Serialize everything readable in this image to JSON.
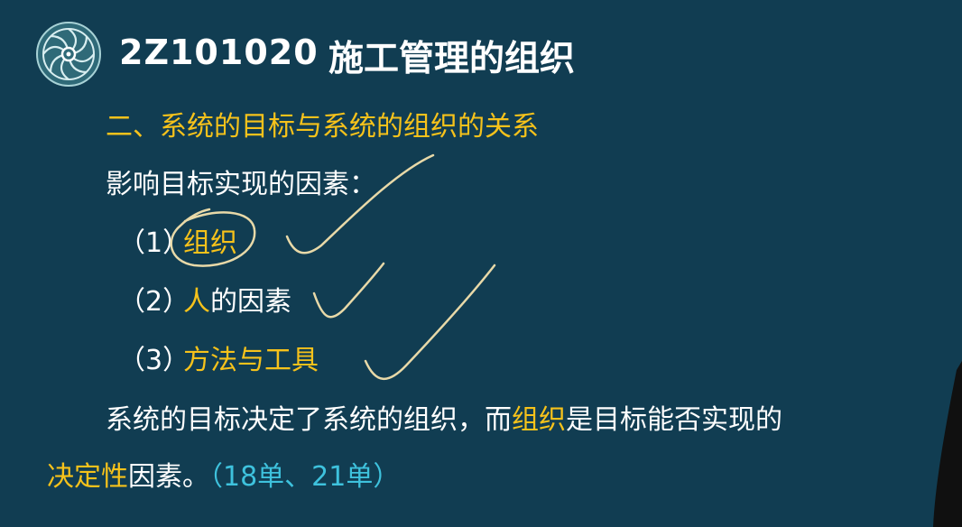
{
  "header": {
    "code": "2Z101020",
    "title": "施工管理的组织"
  },
  "section": {
    "heading": "二、系统的目标与系统的组织的关系",
    "intro": "影响目标实现的因素："
  },
  "factors": [
    {
      "num": "（1）",
      "highlight": "组织",
      "rest": ""
    },
    {
      "num": "（2）",
      "highlight": "人",
      "rest": "的因素"
    },
    {
      "num": "（3）",
      "highlight": "方法与工具",
      "rest": ""
    }
  ],
  "conclusion": {
    "part1": "系统的目标决定了系统的组织，而",
    "highlight1": "组织",
    "part2": "是目标能否实现的",
    "highlight2": "决定性",
    "part3": "因素。",
    "exam_note": "（18单、21单）"
  },
  "colors": {
    "background": "#113d52",
    "highlight": "#f6c21b",
    "note": "#3ec2dd",
    "ink": "#e8d9a8"
  },
  "icons": {
    "logo": "spiral-emblem-icon"
  }
}
